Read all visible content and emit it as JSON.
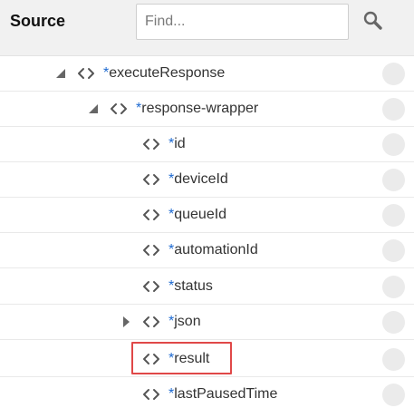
{
  "panel": {
    "title": "Source",
    "search": {
      "placeholder": "Find...",
      "value": ""
    },
    "search_icon": "magnifier-icon"
  },
  "tree": [
    {
      "label": "executeResponse",
      "required": "*",
      "level": 1,
      "state": "expanded"
    },
    {
      "label": "response-wrapper",
      "required": "*",
      "level": 2,
      "state": "expanded"
    },
    {
      "label": "id",
      "required": "*",
      "level": 3,
      "state": "leaf"
    },
    {
      "label": "deviceId",
      "required": "*",
      "level": 3,
      "state": "leaf"
    },
    {
      "label": "queueId",
      "required": "*",
      "level": 3,
      "state": "leaf"
    },
    {
      "label": "automationId",
      "required": "*",
      "level": 3,
      "state": "leaf"
    },
    {
      "label": "status",
      "required": "*",
      "level": 3,
      "state": "leaf"
    },
    {
      "label": "json",
      "required": "*",
      "level": 3,
      "state": "collapsed"
    },
    {
      "label": "result",
      "required": "*",
      "level": 3,
      "state": "leaf",
      "highlighted": true
    },
    {
      "label": "lastPausedTime",
      "required": "*",
      "level": 3,
      "state": "leaf"
    }
  ],
  "colors": {
    "header_bg": "#f1f1f1",
    "required_marker": "#1e6ad1",
    "highlight_border": "#e04848",
    "status_circle": "#ebebeb"
  }
}
